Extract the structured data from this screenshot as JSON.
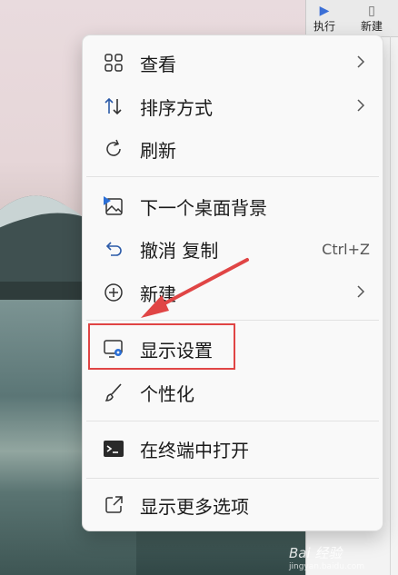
{
  "menu": {
    "items": [
      {
        "label": "查看",
        "icon": "grid-view-icon",
        "submenu": true
      },
      {
        "label": "排序方式",
        "icon": "sort-icon",
        "submenu": true
      },
      {
        "label": "刷新",
        "icon": "refresh-icon"
      },
      {
        "label": "下一个桌面背景",
        "icon": "next-background-icon"
      },
      {
        "label": "撤消 复制",
        "icon": "undo-icon",
        "shortcut": "Ctrl+Z"
      },
      {
        "label": "新建",
        "icon": "new-plus-icon",
        "submenu": true
      },
      {
        "label": "显示设置",
        "icon": "display-settings-icon",
        "highlighted": true
      },
      {
        "label": "个性化",
        "icon": "brush-icon"
      },
      {
        "label": "在终端中打开",
        "icon": "terminal-icon"
      },
      {
        "label": "显示更多选项",
        "icon": "open-more-icon"
      }
    ]
  },
  "annotation": {
    "box_color": "#e04545",
    "arrow_color": "#e04545"
  },
  "background_window": {
    "toolbar": [
      "执行",
      "新建"
    ]
  },
  "watermark": {
    "brand": "Bai 经验",
    "url": "jingyan.baidu.com"
  }
}
